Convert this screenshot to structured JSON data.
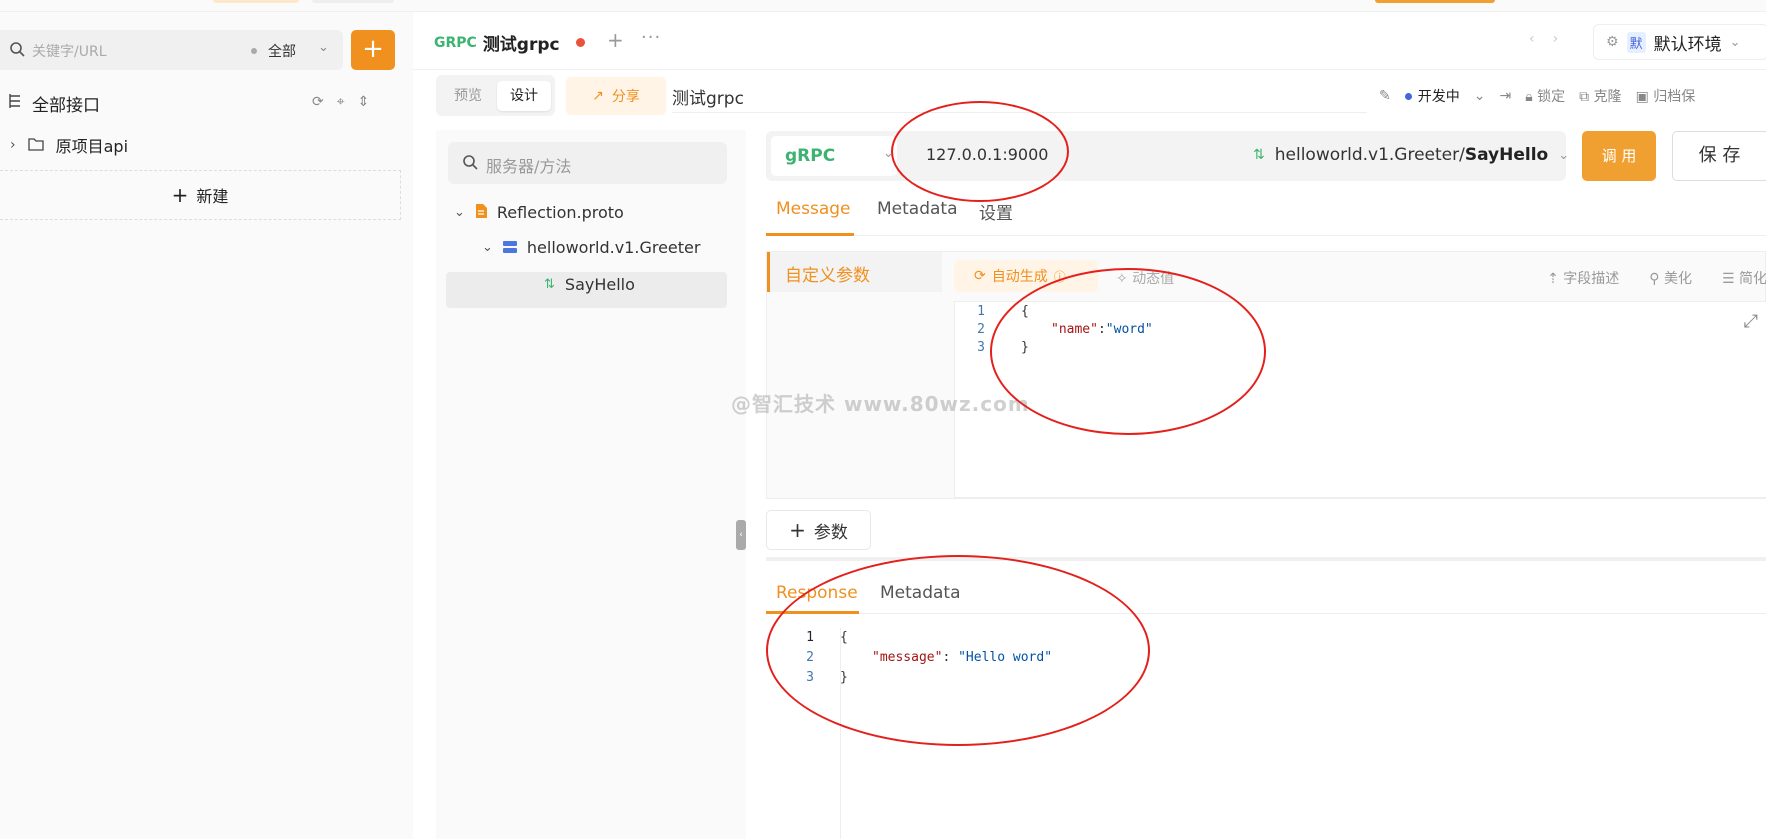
{
  "sidebar": {
    "search_placeholder": "关键字/URL",
    "scope": "全部",
    "add_label": "+",
    "section_title": "全部接口",
    "tree": [
      {
        "label": "原项目api"
      }
    ],
    "new_label": "新建"
  },
  "tabbar": {
    "tab_protocol": "GRPC",
    "tab_name": "测试grpc",
    "plus": "+",
    "more": "···",
    "env_badge": "默",
    "env_name": "默认环境"
  },
  "toolbar": {
    "mode_preview": "预览",
    "mode_design": "设计",
    "share_label": "分享",
    "doc_name": "测试grpc",
    "status": "开发中",
    "lock": "锁定",
    "clone": "克隆",
    "archive": "归档保"
  },
  "service_panel": {
    "search_placeholder": "服务器/方法",
    "proto_file": "Reflection.proto",
    "service": "helloworld.v1.Greeter",
    "method": "SayHello"
  },
  "request": {
    "protocol": "gRPC",
    "address": "127.0.0.1:9000",
    "method_prefix": "helloworld.v1.Greeter/",
    "method_name": "SayHello",
    "invoke_label": "调 用",
    "save_label": "保 存"
  },
  "message_tabs": [
    "Message",
    "Metadata",
    "设置"
  ],
  "message_panel": {
    "side_label": "自定义参数",
    "autogen_label": "自动生成",
    "dynamic_label": "动态值",
    "tools": [
      "字段描述",
      "美化",
      "简化"
    ],
    "code_lines": [
      {
        "n": "1",
        "text": "{"
      },
      {
        "n": "2",
        "key": "\"name\"",
        "sep": ":",
        "val": "\"word\""
      },
      {
        "n": "3",
        "text": "}"
      }
    ]
  },
  "add_param_label": "参数",
  "response_tabs": [
    "Response",
    "Metadata"
  ],
  "response_code": [
    {
      "n": "1",
      "text": "{"
    },
    {
      "n": "2",
      "key": "\"message\"",
      "sep": ": ",
      "val": "\"Hello word\""
    },
    {
      "n": "3",
      "text": "}"
    }
  ],
  "watermark": "@智汇技术  www.80wz.com",
  "colors": {
    "accent": "#f0901e",
    "grpc_green": "#3cb371",
    "annotation_red": "#e3201b"
  }
}
